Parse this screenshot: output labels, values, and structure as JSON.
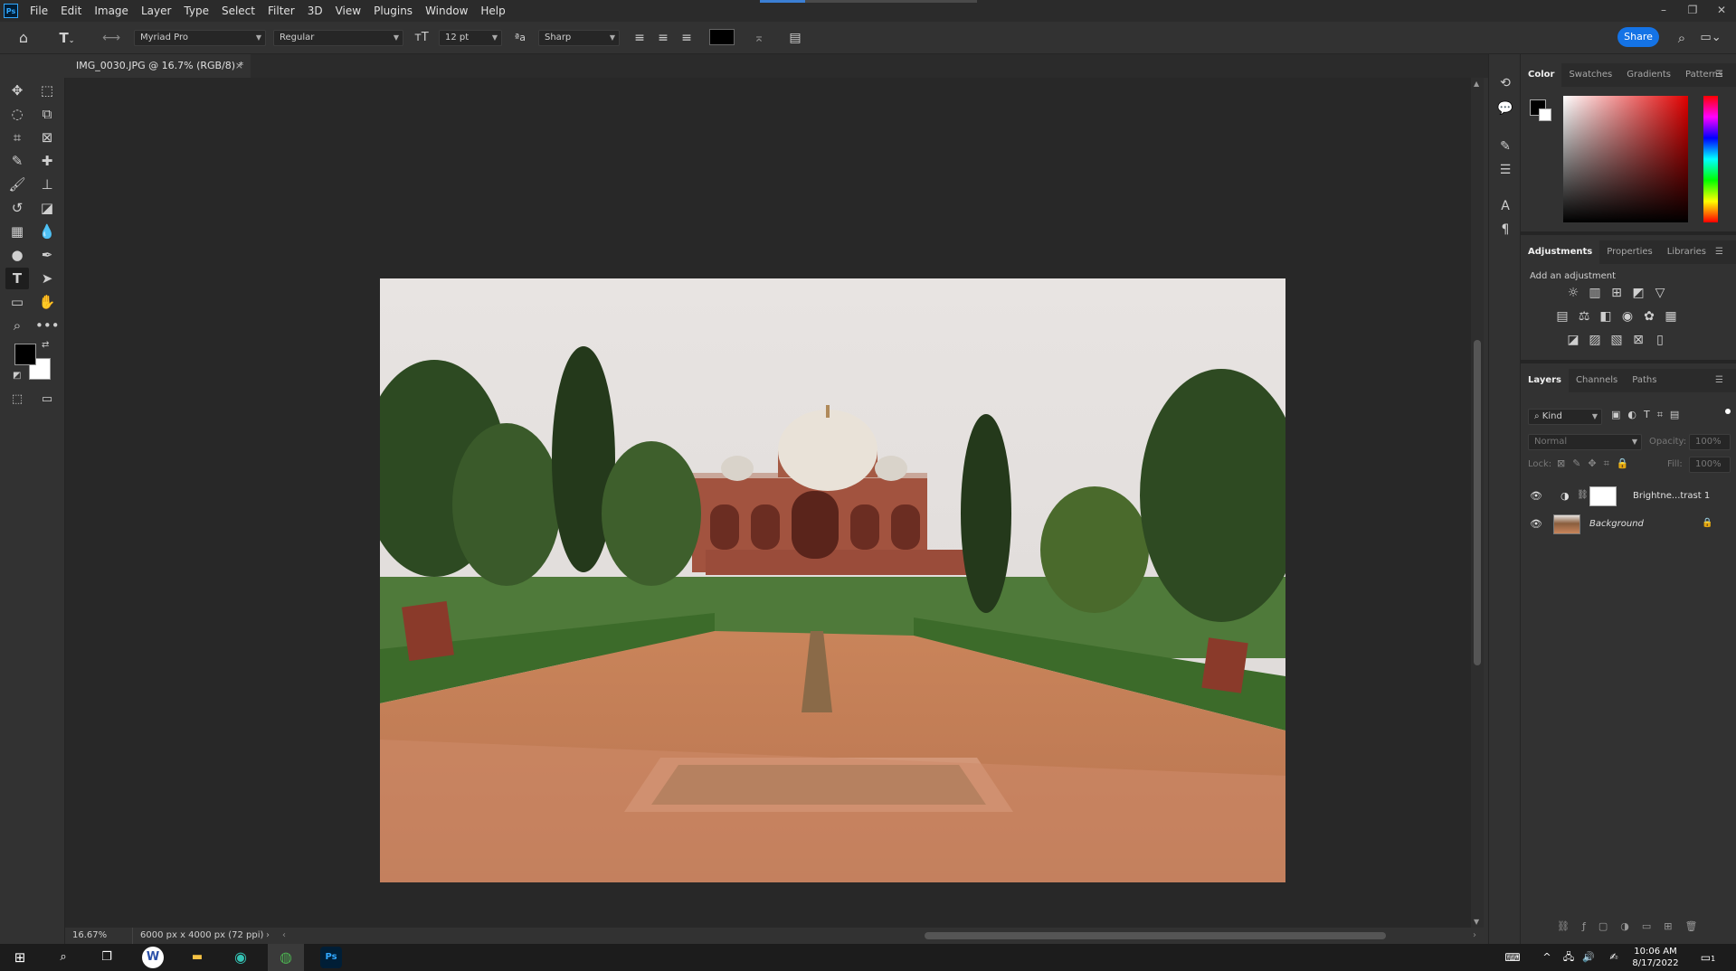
{
  "app": {
    "logo": "Ps"
  },
  "menu": [
    "File",
    "Edit",
    "Image",
    "Layer",
    "Type",
    "Select",
    "Filter",
    "3D",
    "View",
    "Plugins",
    "Window",
    "Help"
  ],
  "window_controls": {
    "minimize": "–",
    "restore": "❐",
    "close": "✕"
  },
  "options": {
    "font_family": "Myriad Pro",
    "font_style": "Regular",
    "font_size": "12 pt",
    "antialias_glyph": "ªa",
    "antialias": "Sharp",
    "text_color": "#000000",
    "share_label": "Share"
  },
  "document": {
    "tab_title": "IMG_0030.JPG @ 16.7% (RGB/8) *",
    "close": "×",
    "zoom": "16.67%",
    "dimensions": "6000 px x 4000 px (72 ppi)"
  },
  "panels": {
    "color_tabs": [
      "Color",
      "Swatches",
      "Gradients",
      "Patterns"
    ],
    "adjust_tabs": [
      "Adjustments",
      "Properties",
      "Libraries"
    ],
    "add_adjustment": "Add an adjustment",
    "layers_tabs": [
      "Layers",
      "Channels",
      "Paths"
    ],
    "kind": "Kind",
    "blend_mode": "Normal",
    "opacity_label": "Opacity:",
    "opacity_value": "100%",
    "lock_label": "Lock:",
    "fill_label": "Fill:",
    "fill_value": "100%",
    "layers": [
      {
        "name": "Brightne...trast 1"
      },
      {
        "name": "Background"
      }
    ]
  },
  "taskbar": {
    "time": "10:06 AM",
    "date": "8/17/2022",
    "notif_count": "1"
  },
  "colors": {
    "foreground": "#000000",
    "background": "#ffffff",
    "accent": "#1473e6"
  }
}
